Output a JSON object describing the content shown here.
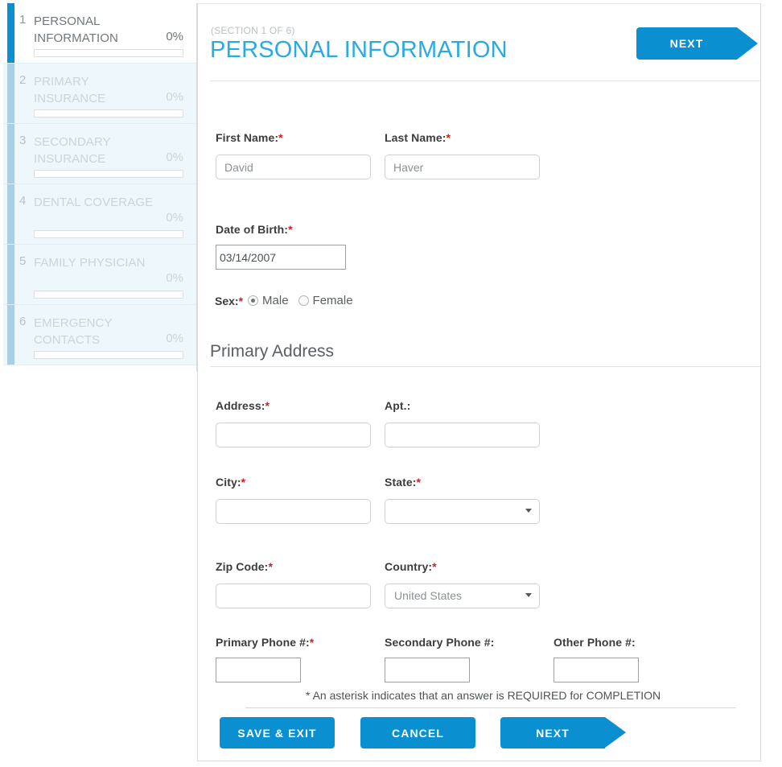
{
  "sidebar": {
    "steps": [
      {
        "num": "1",
        "label": "PERSONAL INFORMATION",
        "percent": "0%",
        "progress": 0,
        "active": true
      },
      {
        "num": "2",
        "label": "PRIMARY INSURANCE",
        "percent": "0%",
        "progress": 0,
        "active": false
      },
      {
        "num": "3",
        "label": "SECONDARY INSURANCE",
        "percent": "0%",
        "progress": 0,
        "active": false
      },
      {
        "num": "4",
        "label": "DENTAL COVERAGE",
        "percent": "0%",
        "progress": 0,
        "active": false
      },
      {
        "num": "5",
        "label": "FAMILY PHYSICIAN",
        "percent": "0%",
        "progress": 0,
        "active": false
      },
      {
        "num": "6",
        "label": "EMERGENCY CONTACTS",
        "percent": "0%",
        "progress": 0,
        "active": false
      }
    ]
  },
  "header": {
    "section_of": "(SECTION 1 OF 6)",
    "title": "PERSONAL INFORMATION",
    "next_label": "NEXT"
  },
  "form": {
    "first_name": {
      "label": "First Name:",
      "required": "*",
      "value": "David"
    },
    "last_name": {
      "label": "Last Name:",
      "required": "*",
      "value": "Haver"
    },
    "dob": {
      "label": "Date of Birth:",
      "required": "*",
      "value": "03/14/2007"
    },
    "sex": {
      "label": "Sex:",
      "required": "*",
      "options": [
        {
          "label": "Male",
          "selected": true
        },
        {
          "label": "Female",
          "selected": false
        }
      ]
    },
    "primary_address_heading": "Primary Address",
    "address": {
      "label": "Address:",
      "required": "*",
      "value": ""
    },
    "apt": {
      "label": "Apt.:",
      "required": "",
      "value": ""
    },
    "city": {
      "label": "City:",
      "required": "*",
      "value": ""
    },
    "state": {
      "label": "State:",
      "required": "*",
      "value": ""
    },
    "zip": {
      "label": "Zip Code:",
      "required": "*",
      "value": ""
    },
    "country": {
      "label": "Country:",
      "required": "*",
      "value": "United States"
    },
    "primary_phone": {
      "label": "Primary Phone #:",
      "required": "*",
      "value": ""
    },
    "secondary_phone": {
      "label": "Secondary Phone #:",
      "required": "",
      "value": ""
    },
    "other_phone": {
      "label": "Other Phone #:",
      "required": "",
      "value": ""
    }
  },
  "footer": {
    "note": "* An asterisk indicates that an answer is REQUIRED for COMPLETION",
    "save_exit_label": "SAVE & EXIT",
    "cancel_label": "CANCEL",
    "next_label": "NEXT"
  },
  "colors": {
    "accent_blue": "#0a8fd0",
    "title_blue": "#29abe2",
    "required_red": "#cc2127",
    "step_inactive_bg": "#eef7fc",
    "step_inactive_bar": "#a6d0ea"
  }
}
